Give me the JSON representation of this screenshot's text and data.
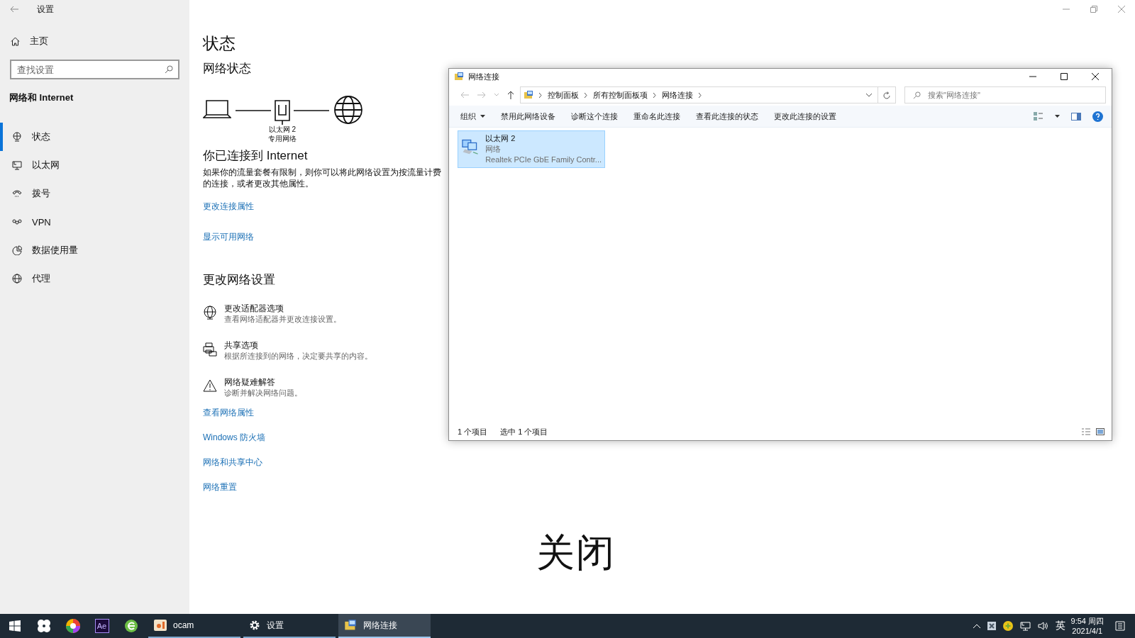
{
  "settings": {
    "title": "设置",
    "home": "主页",
    "search": {
      "placeholder": "查找设置"
    },
    "section": "网络和 Internet",
    "nav": [
      {
        "label": "状态",
        "kind": "status",
        "selected": true
      },
      {
        "label": "以太网",
        "kind": "ethernet",
        "selected": false
      },
      {
        "label": "拨号",
        "kind": "dialup",
        "selected": false
      },
      {
        "label": "VPN",
        "kind": "vpn",
        "selected": false
      },
      {
        "label": "数据使用量",
        "kind": "data",
        "selected": false
      },
      {
        "label": "代理",
        "kind": "proxy",
        "selected": false
      }
    ]
  },
  "main": {
    "heading": "状态",
    "network_status": "网络状态",
    "diagram": {
      "adapter": "以太网 2",
      "network": "专用网络"
    },
    "connected": "你已连接到 Internet",
    "description": "如果你的流量套餐有限制，则你可以将此网络设置为按流量计费的连接，或者更改其他属性。",
    "links": [
      "更改连接属性",
      "显示可用网络"
    ],
    "change_heading": "更改网络设置",
    "options": [
      {
        "kind": "adapter",
        "title": "更改适配器选项",
        "desc": "查看网络适配器并更改连接设置。"
      },
      {
        "kind": "sharing",
        "title": "共享选项",
        "desc": "根据所连接到的网络，决定要共享的内容。"
      },
      {
        "kind": "troubleshoot",
        "title": "网络疑难解答",
        "desc": "诊断并解决网络问题。"
      }
    ],
    "more_links": [
      "查看网络属性",
      "Windows 防火墙",
      "网络和共享中心",
      "网络重置"
    ]
  },
  "caption": "关闭",
  "explorer": {
    "title": "网络连接",
    "breadcrumb": [
      "控制面板",
      "所有控制面板项",
      "网络连接"
    ],
    "search": {
      "placeholder": "搜索\"网络连接\""
    },
    "organize": "组织",
    "commands": [
      "禁用此网络设备",
      "诊断这个连接",
      "重命名此连接",
      "查看此连接的状态",
      "更改此连接的设置"
    ],
    "items": [
      {
        "name": "以太网 2",
        "status": "网络",
        "device": "Realtek PCIe GbE Family Contr...",
        "selected": true
      }
    ],
    "status_bar": {
      "count": "1 个项目",
      "selection": "选中 1 个项目"
    }
  },
  "taskbar": {
    "pinned": [
      {
        "kind": "start"
      },
      {
        "kind": "pinwheel"
      },
      {
        "kind": "browser"
      },
      {
        "kind": "ae",
        "label": "Ae"
      },
      {
        "kind": "ie"
      }
    ],
    "windows": [
      {
        "kind": "ocam",
        "label": "ocam",
        "selected": false
      },
      {
        "kind": "settings",
        "label": "设置",
        "selected": false
      },
      {
        "kind": "network",
        "label": "网络连接",
        "selected": true
      }
    ],
    "ime": "英",
    "time": "9:54 周四",
    "date": "2021/4/1"
  }
}
